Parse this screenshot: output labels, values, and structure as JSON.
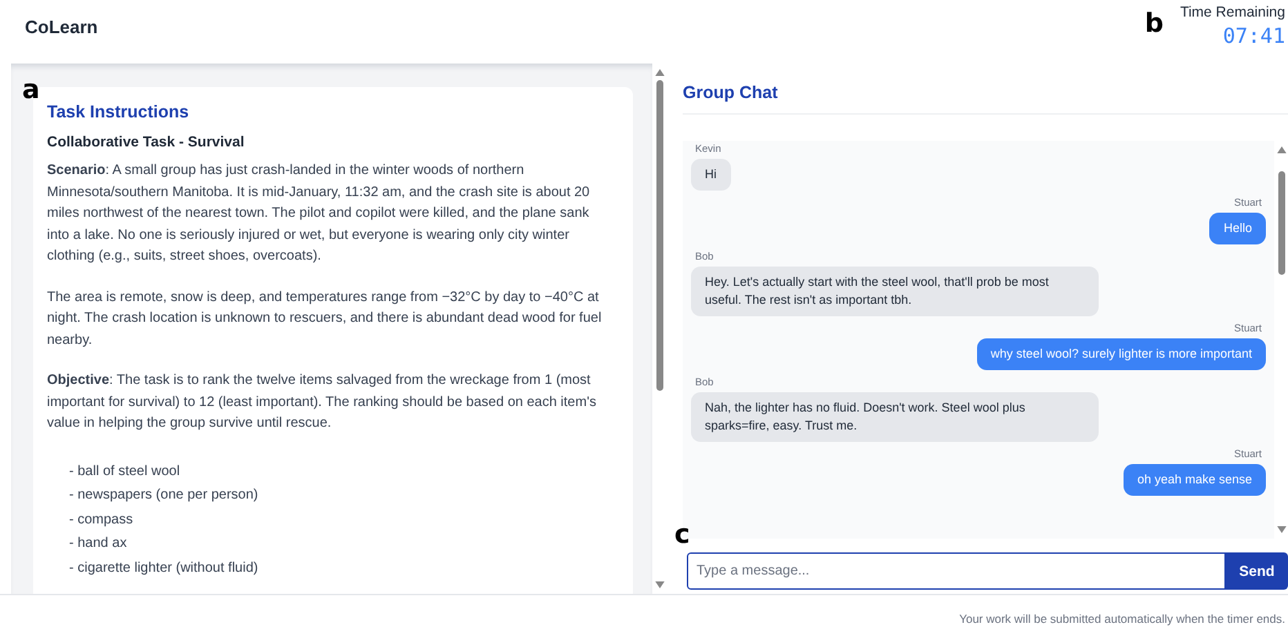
{
  "app": {
    "title": "CoLearn"
  },
  "timer": {
    "label": "Time Remaining",
    "value": "07:41"
  },
  "instructions": {
    "heading": "Task Instructions",
    "subheading": "Collaborative Task - Survival",
    "paragraphs": [
      "**Scenario**: A small group has just crash-landed in the winter woods of northern Minnesota/southern Manitoba. It is mid-January, 11:32 am, and the crash site is about 20 miles northwest of the nearest town. The pilot and copilot were killed, and the plane sank into a lake. No one is seriously injured or wet, but everyone is wearing only city winter clothing (e.g., suits, street shoes, overcoats).",
      "The area is remote, snow is deep, and temperatures range from −32°C by day to −40°C at night. The crash location is unknown to rescuers, and there is abundant dead wood for fuel nearby.",
      "**Objective**: The task is to rank the twelve items salvaged from the wreckage from 1 (most important for survival) to 12 (least important). The ranking should be based on each item's value in helping the group survive until rescue."
    ],
    "items": [
      "- ball of steel wool",
      "- newspapers (one per person)",
      "- compass",
      "- hand ax",
      "- cigarette lighter (without fluid)"
    ]
  },
  "chat": {
    "heading": "Group Chat",
    "messages": [
      {
        "sender": "Kevin",
        "text": "Hi",
        "own": false
      },
      {
        "sender": "Stuart",
        "text": "Hello",
        "own": true
      },
      {
        "sender": "Bob",
        "text": "Hey. Let's actually start with the steel wool, that'll prob be most useful. The rest isn't as important tbh.",
        "own": false
      },
      {
        "sender": "Stuart",
        "text": "why steel wool? surely lighter is more important",
        "own": true
      },
      {
        "sender": "Bob",
        "text": "Nah, the lighter has no fluid. Doesn't work. Steel wool plus sparks=fire, easy. Trust me.",
        "own": false
      },
      {
        "sender": "Stuart",
        "text": "oh yeah make sense",
        "own": true
      }
    ],
    "input": {
      "placeholder": "Type a message..."
    },
    "send_button": "Send"
  },
  "footer": "Your work will be submitted automatically when the timer ends.",
  "annotations": [
    "a",
    "b",
    "c"
  ]
}
